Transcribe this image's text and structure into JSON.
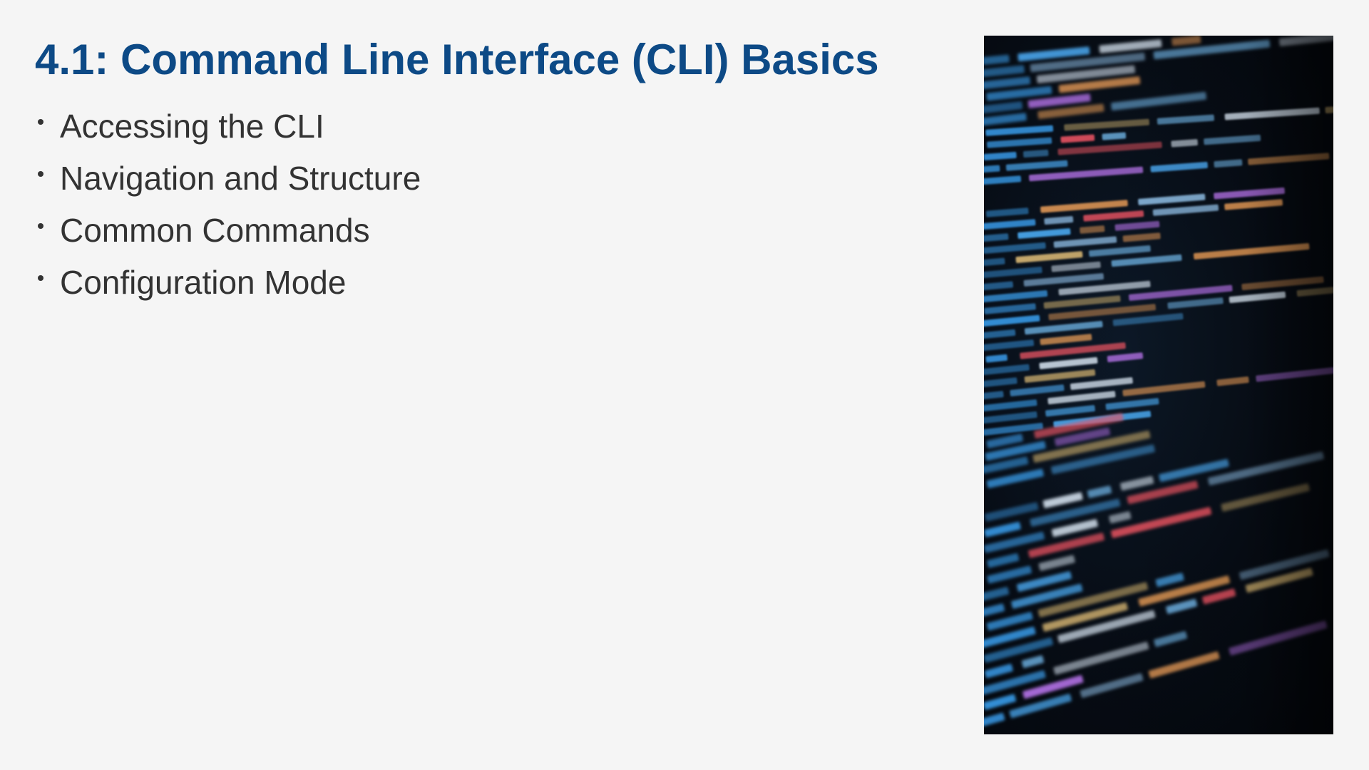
{
  "slide": {
    "title": "4.1: Command Line Interface (CLI) Basics",
    "bullets": [
      "Accessing the CLI",
      "Navigation and Structure",
      "Common Commands",
      "Configuration Mode"
    ]
  },
  "image": {
    "icon": "terminal-code-photo",
    "colors": {
      "background": "#f5f5f5",
      "title": "#0d4a86",
      "body_text": "#333333",
      "screen": "#060c14"
    }
  }
}
